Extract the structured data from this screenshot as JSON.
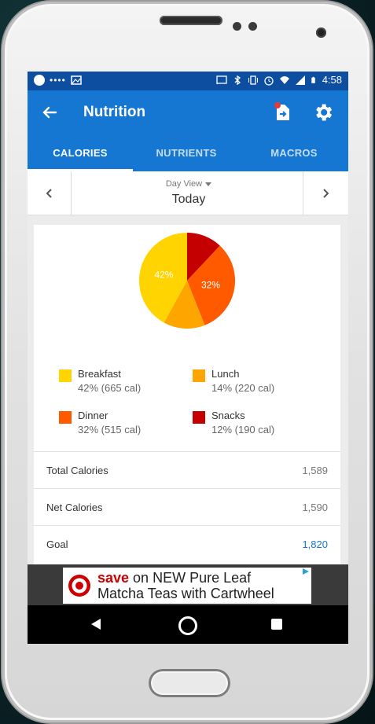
{
  "status": {
    "time": "4:58"
  },
  "appbar": {
    "title": "Nutrition",
    "back_icon": "arrow-back-icon",
    "export_icon": "file-export-icon",
    "settings_icon": "gear-icon"
  },
  "tabs": [
    {
      "label": "CALORIES",
      "active": true
    },
    {
      "label": "NUTRIENTS",
      "active": false
    },
    {
      "label": "MACROS",
      "active": false
    }
  ],
  "dayview": {
    "label": "Day View",
    "value": "Today"
  },
  "chart_data": {
    "type": "pie",
    "slices": [
      {
        "name": "Breakfast",
        "percent": 42,
        "calories": 665,
        "color": "#ffd400"
      },
      {
        "name": "Lunch",
        "percent": 14,
        "calories": 220,
        "color": "#ffa500"
      },
      {
        "name": "Dinner",
        "percent": 32,
        "calories": 515,
        "color": "#ff5a00"
      },
      {
        "name": "Snacks",
        "percent": 12,
        "calories": 190,
        "color": "#c40000"
      }
    ],
    "slice_labels": [
      "42%",
      "32%"
    ]
  },
  "legend": [
    {
      "name": "Breakfast",
      "detail": "42% (665 cal)",
      "color": "#ffd400"
    },
    {
      "name": "Lunch",
      "detail": "14% (220 cal)",
      "color": "#ffa500"
    },
    {
      "name": "Dinner",
      "detail": "32% (515 cal)",
      "color": "#ff5a00"
    },
    {
      "name": "Snacks",
      "detail": "12% (190 cal)",
      "color": "#c40000"
    }
  ],
  "summary": [
    {
      "label": "Total Calories",
      "value": "1,589"
    },
    {
      "label": "Net Calories",
      "value": "1,590"
    },
    {
      "label": "Goal",
      "value": "1,820"
    }
  ],
  "ad": {
    "highlight": "save",
    "line1_rest": " on NEW Pure Leaf",
    "line2": "Matcha Teas with Cartwheel"
  },
  "colors": {
    "primary": "#1577d2",
    "statusbar": "#0d4ea0",
    "goal": "#1577d2"
  }
}
